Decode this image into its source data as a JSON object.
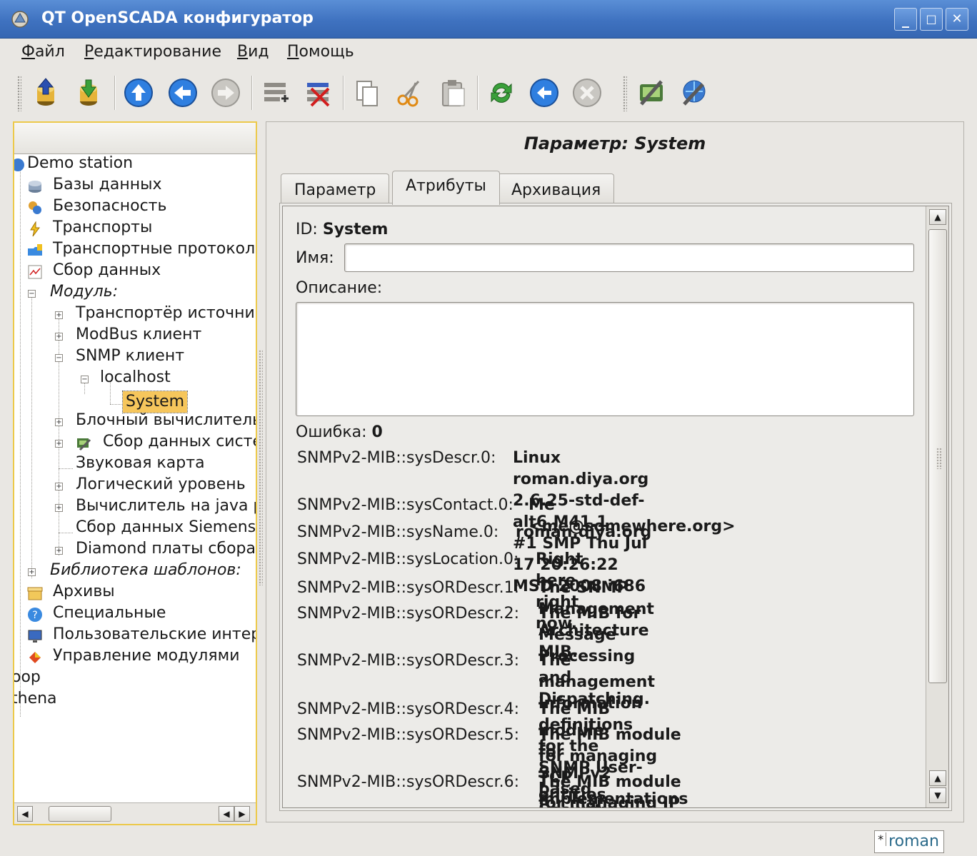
{
  "window": {
    "title": "QT OpenSCADA конфигуратор",
    "buttons": [
      "_",
      "□",
      "✕"
    ]
  },
  "menu": [
    {
      "label": "Файл",
      "u": "Ф",
      "rest": "айл"
    },
    {
      "label": "Редактирование",
      "u": "Р",
      "rest": "едактирование"
    },
    {
      "label": "Вид",
      "u": "В",
      "rest": "ид"
    },
    {
      "label": "Помощь",
      "u": "П",
      "rest": "омощь"
    }
  ],
  "toolbar": {
    "icons": [
      "db-load-icon",
      "db-save-icon",
      "up-icon",
      "back-icon",
      "forward-icon",
      "item-add-icon",
      "item-delete-icon",
      "copy-icon",
      "cut-icon",
      "paste-icon",
      "refresh-icon",
      "start-icon",
      "stop-icon",
      "qt-config-icon",
      "web-config-icon"
    ]
  },
  "tree": {
    "nodes": [
      {
        "label": "Demo station"
      },
      {
        "label": "Базы данных"
      },
      {
        "label": "Безопасность"
      },
      {
        "label": "Транспорты"
      },
      {
        "label": "Транспортные протоколы"
      },
      {
        "label": "Сбор данных"
      },
      {
        "label": "Модуль:"
      },
      {
        "label": "Транспортёр источника"
      },
      {
        "label": "ModBus клиент"
      },
      {
        "label": "SNMP клиент"
      },
      {
        "label": "localhost"
      },
      {
        "label": "System"
      },
      {
        "label": "Блочный вычислитель"
      },
      {
        "label": "Сбор данных системы"
      },
      {
        "label": "Звуковая карта"
      },
      {
        "label": "Логический уровень"
      },
      {
        "label": "Вычислитель на java p"
      },
      {
        "label": "Сбор данных Siemens"
      },
      {
        "label": "Diamond платы сбора"
      },
      {
        "label": "Библиотека шаблонов:"
      },
      {
        "label": "Архивы"
      },
      {
        "label": "Специальные"
      },
      {
        "label": "Пользовательские интерфейсы"
      },
      {
        "label": "Управление модулями"
      },
      {
        "label": "oop"
      },
      {
        "label": "thena"
      }
    ]
  },
  "panel": {
    "title": "Параметр: System",
    "tabs": [
      "Параметр",
      "Атрибуты",
      "Архивация"
    ],
    "active_tab": "Атрибуты",
    "id_label": "ID:",
    "id_value": "System",
    "name_label": "Имя:",
    "name_value": "",
    "descr_label": "Описание:",
    "descr_value": "",
    "error_label": "Ошибка:",
    "error_value": "0",
    "attributes": [
      {
        "key": "SNMPv2-MIB::sysDescr.0:",
        "value": "Linux roman.diya.org 2.6.25-std-def-alt6.M41.1\n#1 SMP Thu Jul 17 20:26:22 MSD 2008 i686"
      },
      {
        "key": "SNMPv2-MIB::sysContact.0:",
        "value": "Me <me@somewhere.org>"
      },
      {
        "key": "SNMPv2-MIB::sysName.0:",
        "value": "roman.diya.org"
      },
      {
        "key": "SNMPv2-MIB::sysLocation.0:",
        "value": "Right here, right now."
      },
      {
        "key": "SNMPv2-MIB::sysORDescr.1:",
        "value": "The SNMP Management Architecture MIB."
      },
      {
        "key": "SNMPv2-MIB::sysORDescr.2:",
        "value": "The MIB for Message Processing and\nDispatching."
      },
      {
        "key": "SNMPv2-MIB::sysORDescr.3:",
        "value": "The management information definitions\nfor the SNMP User-based Security Model."
      },
      {
        "key": "SNMPv2-MIB::sysORDescr.4:",
        "value": "The MIB module for SNMPv2 entities"
      },
      {
        "key": "SNMPv2-MIB::sysORDescr.5:",
        "value": "The MIB module for managing TCP\nimplementations"
      },
      {
        "key": "SNMPv2-MIB::sysORDescr.6:",
        "value": "The MIB module for managing IP and ICMP\nimplementations"
      }
    ]
  },
  "status": {
    "modified_mark": "*",
    "user": "roman"
  },
  "colors": {
    "titlebar": "#3f72c0",
    "selection": "#f6c65c",
    "focus_border": "#ecc94a"
  }
}
